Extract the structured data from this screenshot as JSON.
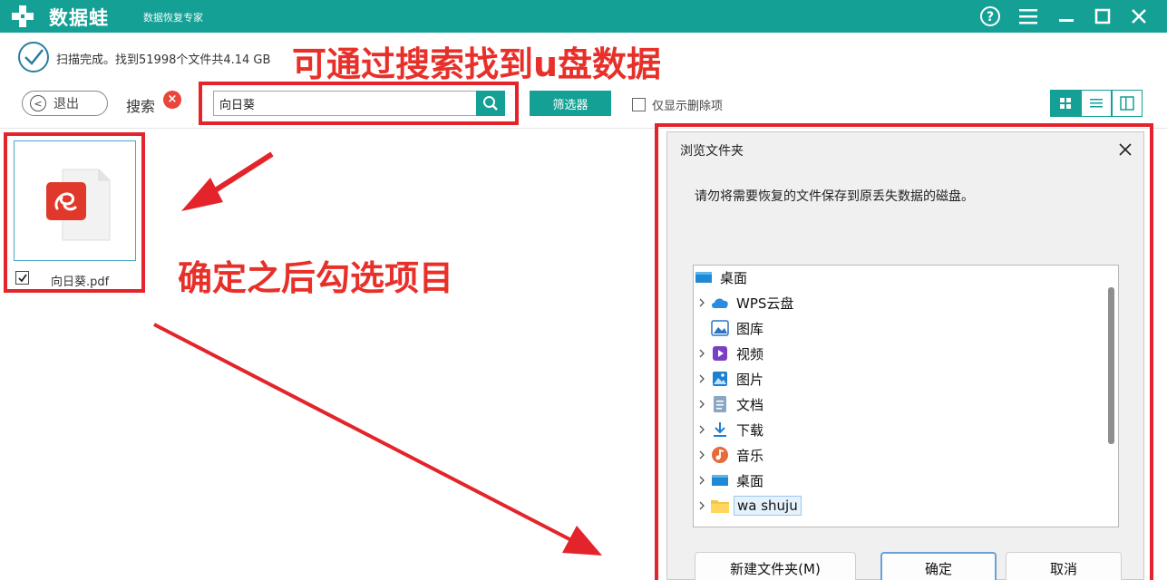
{
  "app": {
    "name": "数据蛙",
    "slogan": "数据恢复专家",
    "accent_color": "#14a095",
    "titlebar_buttons": [
      "help-icon",
      "menu-icon",
      "minimize-icon",
      "maximize-icon",
      "close-icon"
    ]
  },
  "status": {
    "text": "扫描完成。找到51998个文件共4.14 GB"
  },
  "annotations": {
    "top": "可通过搜索找到u盘数据",
    "middle": "确定之后勾选项目",
    "color": "#e3242b"
  },
  "toolbar": {
    "back_label": "退出",
    "search_label": "搜索",
    "search_value": "向日葵",
    "filter_label": "筛选器",
    "only_deleted_label": "仅显示删除项",
    "views": [
      "grid-view-icon",
      "list-view-icon",
      "column-view-icon"
    ],
    "active_view": "grid-view-icon"
  },
  "file": {
    "name": "向日葵.pdf",
    "checked": true,
    "icon": "pdf-file-icon"
  },
  "dialog": {
    "title": "浏览文件夹",
    "message": "请勿将需要恢复的文件保存到原丢失数据的磁盘。",
    "tree": [
      {
        "label": "桌面",
        "icon": "desktop-icon",
        "expandable": false,
        "indent": 0
      },
      {
        "label": "WPS云盘",
        "icon": "cloud-icon",
        "expandable": true,
        "indent": 1
      },
      {
        "label": "图库",
        "icon": "gallery-icon",
        "expandable": false,
        "indent": 1
      },
      {
        "label": "视频",
        "icon": "video-icon",
        "expandable": true,
        "indent": 1
      },
      {
        "label": "图片",
        "icon": "pictures-icon",
        "expandable": true,
        "indent": 1
      },
      {
        "label": "文档",
        "icon": "documents-icon",
        "expandable": true,
        "indent": 1
      },
      {
        "label": "下载",
        "icon": "download-icon",
        "expandable": true,
        "indent": 1
      },
      {
        "label": "音乐",
        "icon": "music-icon",
        "expandable": true,
        "indent": 1
      },
      {
        "label": "桌面",
        "icon": "desktop-icon",
        "expandable": true,
        "indent": 1
      },
      {
        "label": "wa shuju",
        "icon": "folder-icon",
        "expandable": true,
        "indent": 1,
        "selected": true
      }
    ],
    "buttons": {
      "new_folder": "新建文件夹(M)",
      "ok": "确定",
      "cancel": "取消"
    }
  }
}
